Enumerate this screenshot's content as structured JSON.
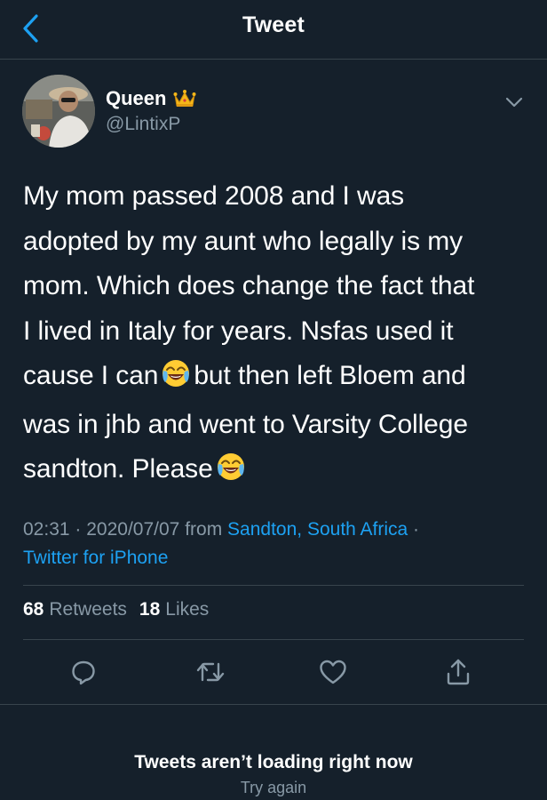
{
  "header": {
    "title": "Tweet",
    "back_icon": "chevron-left-icon"
  },
  "author": {
    "name": "Queen",
    "name_emoji": "crown-icon",
    "handle": "@LintixP",
    "avatar": "avatar-photo"
  },
  "tweet": {
    "lines": [
      "My mom passed 2008 and I was",
      "adopted by my aunt who legally is my",
      "mom. Which does change the fact that",
      "I lived in Italy for years. Nsfas used it"
    ],
    "line5_a": "cause I can",
    "line5_b": "but then left Bloem and",
    "line6": "was in jhb and went to Varsity College",
    "line7": "sandton. Please",
    "emoji": "face-with-tears-of-joy-icon"
  },
  "meta": {
    "time": "02:31",
    "sep1": "·",
    "date": "2020/07/07",
    "from_label": "from",
    "location": "Sandton, South Africa",
    "sep2": "·",
    "source": "Twitter for iPhone"
  },
  "stats": {
    "retweets_count": "68",
    "retweets_label": "Retweets",
    "likes_count": "18",
    "likes_label": "Likes"
  },
  "actions": [
    "reply-icon",
    "retweet-icon",
    "like-icon",
    "share-icon"
  ],
  "footer": {
    "error_title": "Tweets aren’t loading right now",
    "retry_label": "Try again"
  },
  "colors": {
    "background": "#15202b",
    "accent": "#1da1f2",
    "secondary_text": "#8899a6",
    "divider": "#38444d"
  }
}
